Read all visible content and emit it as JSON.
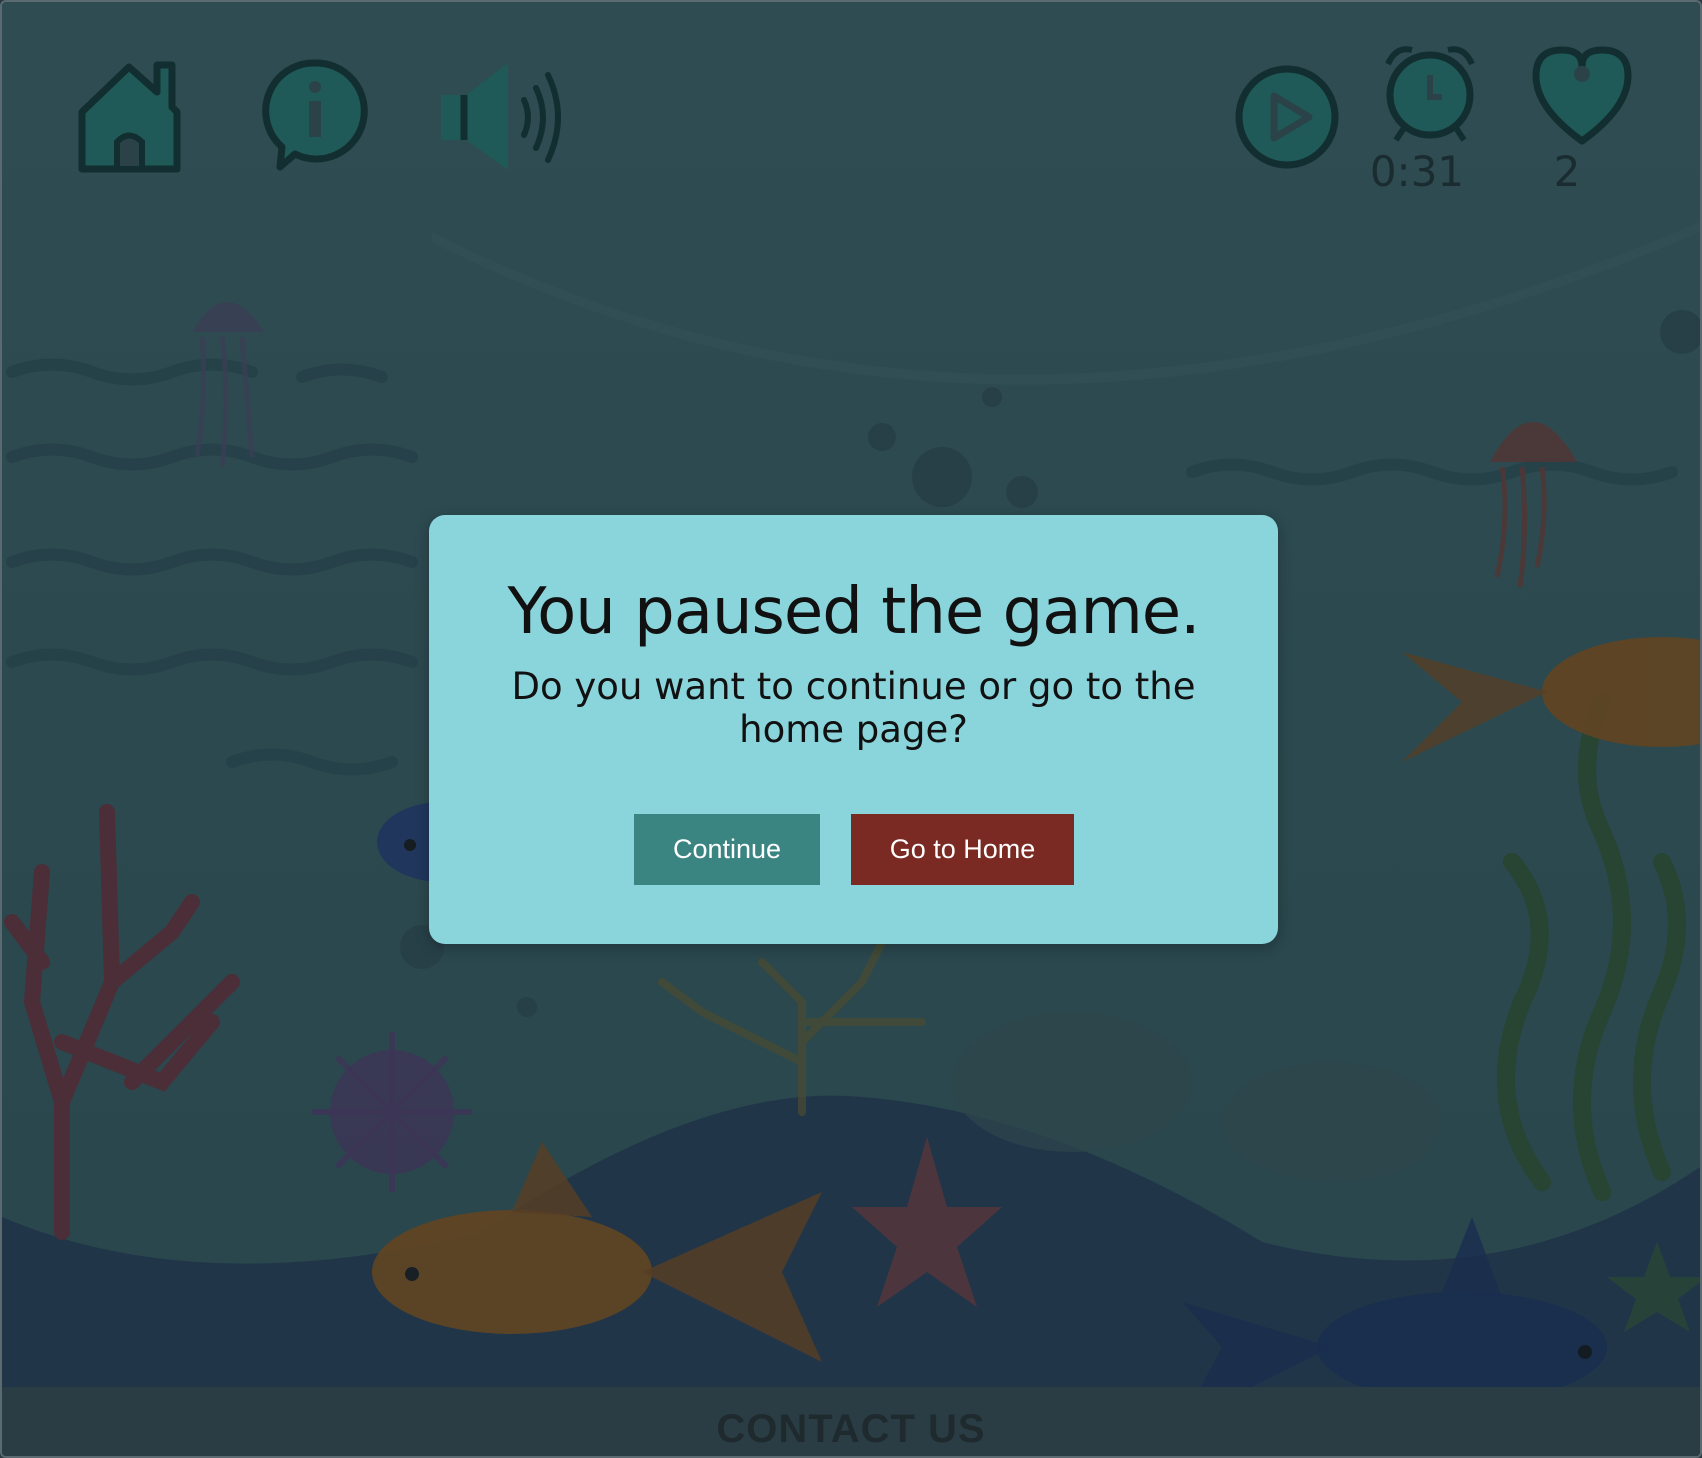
{
  "game": {
    "timer": "0:31",
    "lives": "2"
  },
  "toolbar": {
    "home_icon": "home-icon",
    "info_icon": "info-icon",
    "sound_icon": "speaker-icon",
    "play_icon": "play-icon",
    "timer_icon": "alarm-clock-icon",
    "lives_icon": "heart-icon"
  },
  "pause_dialog": {
    "title": "You paused the game.",
    "message": "Do you want to continue or go to the home page?",
    "continue_label": "Continue",
    "home_label": "Go to Home"
  },
  "footer": {
    "contact_label": "CONTACT US"
  },
  "colors": {
    "dialog_bg": "#8ad5dc",
    "continue_button": "#3a8582",
    "home_button": "#7a2a22",
    "icon_teal": "#1f5a58"
  }
}
